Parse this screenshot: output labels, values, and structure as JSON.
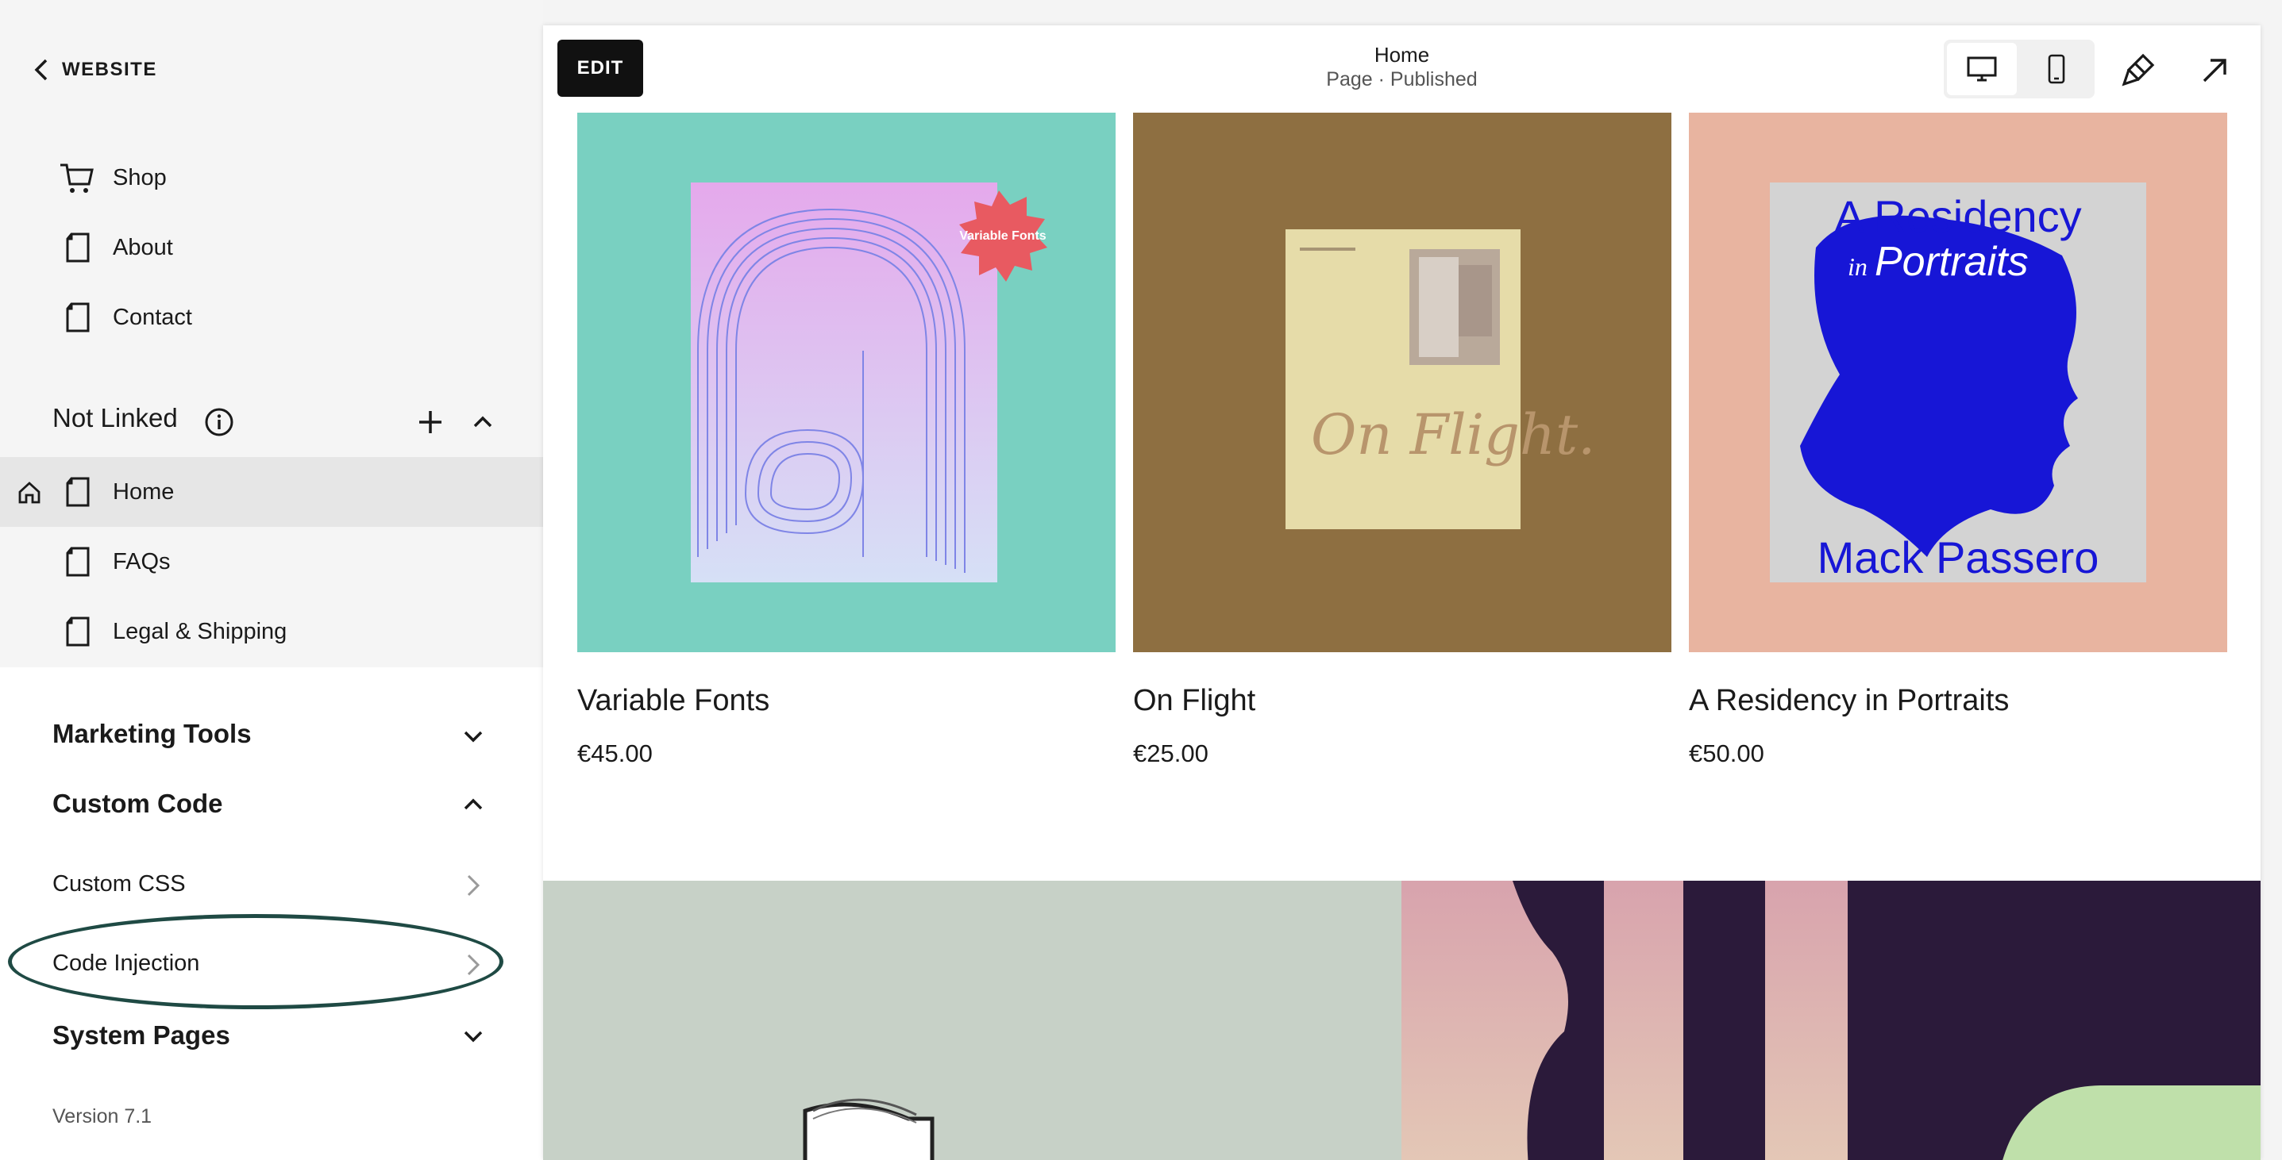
{
  "sidebar": {
    "back_label": "WEBSITE",
    "linked_items": [
      {
        "label": "Shop",
        "icon": "cart-icon"
      },
      {
        "label": "About",
        "icon": "page-icon"
      },
      {
        "label": "Contact",
        "icon": "page-icon"
      }
    ],
    "not_linked": {
      "title": "Not Linked",
      "items": [
        {
          "label": "Home",
          "icon": "page-icon",
          "is_homepage": true,
          "selected": true
        },
        {
          "label": "FAQs",
          "icon": "page-icon"
        },
        {
          "label": "Legal & Shipping",
          "icon": "page-icon"
        }
      ]
    },
    "sections": {
      "marketing_tools": "Marketing Tools",
      "custom_code": "Custom Code",
      "system_pages": "System Pages"
    },
    "custom_code_links": {
      "custom_css": "Custom CSS",
      "code_injection": "Code Injection"
    },
    "version": "Version 7.1",
    "highlight_color": "#1f4a44"
  },
  "toolbar": {
    "edit_label": "EDIT",
    "page_title": "Home",
    "page_status": "Page · Published",
    "icons": [
      "desktop-icon",
      "mobile-icon",
      "paintbrush-icon",
      "external-arrow-icon"
    ]
  },
  "products": [
    {
      "name": "Variable Fonts",
      "price": "€45.00",
      "bg": "#79d0c1",
      "cover_text": "Variable Fonts"
    },
    {
      "name": "On Flight",
      "price": "€25.00",
      "bg": "#8e6f41",
      "cover_text": "On Flight."
    },
    {
      "name": "A Residency in Portraits",
      "price": "€50.00",
      "bg": "#e8b4a0",
      "cover_title_1": "A Residency",
      "cover_title_2": "Portraits",
      "cover_in": "in",
      "cover_author": "Mack Passero"
    }
  ]
}
